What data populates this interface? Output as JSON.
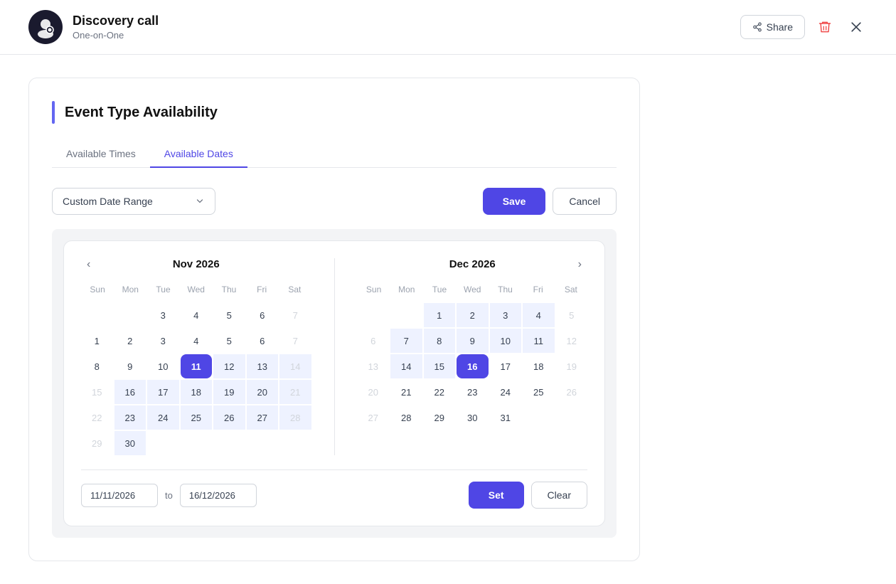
{
  "header": {
    "title": "Discovery call",
    "subtitle": "One-on-One",
    "share_label": "Share",
    "accent_color": "#4f46e5",
    "delete_color": "#ef4444"
  },
  "section": {
    "title": "Event Type Availability"
  },
  "tabs": [
    {
      "label": "Available Times",
      "active": false
    },
    {
      "label": "Available Dates",
      "active": true
    }
  ],
  "toolbar": {
    "dropdown_label": "Custom Date Range",
    "save_label": "Save",
    "cancel_label": "Cancel"
  },
  "calendars": [
    {
      "id": "nov2026",
      "month_label": "Nov 2026",
      "day_headers": [
        "Sun",
        "Mon",
        "Tue",
        "Wed",
        "Thu",
        "Fri",
        "Sat"
      ],
      "weeks": [
        [
          {
            "day": "",
            "state": "empty"
          },
          {
            "day": "",
            "state": "empty"
          },
          {
            "day": "3",
            "state": "normal"
          },
          {
            "day": "4",
            "state": "normal"
          },
          {
            "day": "5",
            "state": "normal"
          },
          {
            "day": "6",
            "state": "normal"
          },
          {
            "day": "7",
            "state": "greyed"
          }
        ],
        [
          {
            "day": "1",
            "state": "normal"
          },
          {
            "day": "2",
            "state": "normal"
          },
          {
            "day": "3",
            "state": "normal"
          },
          {
            "day": "4",
            "state": "normal"
          },
          {
            "day": "5",
            "state": "normal"
          },
          {
            "day": "6",
            "state": "normal"
          },
          {
            "day": "7",
            "state": "greyed"
          }
        ],
        [
          {
            "day": "8",
            "state": "normal"
          },
          {
            "day": "9",
            "state": "normal"
          },
          {
            "day": "10",
            "state": "normal"
          },
          {
            "day": "11",
            "state": "selected"
          },
          {
            "day": "12",
            "state": "in-range"
          },
          {
            "day": "13",
            "state": "in-range"
          },
          {
            "day": "14",
            "state": "in-range-greyed"
          }
        ],
        [
          {
            "day": "15",
            "state": "greyed"
          },
          {
            "day": "16",
            "state": "in-range"
          },
          {
            "day": "17",
            "state": "in-range"
          },
          {
            "day": "18",
            "state": "in-range"
          },
          {
            "day": "19",
            "state": "in-range"
          },
          {
            "day": "20",
            "state": "in-range"
          },
          {
            "day": "21",
            "state": "in-range-greyed"
          }
        ],
        [
          {
            "day": "22",
            "state": "greyed"
          },
          {
            "day": "23",
            "state": "in-range"
          },
          {
            "day": "24",
            "state": "in-range"
          },
          {
            "day": "25",
            "state": "in-range"
          },
          {
            "day": "26",
            "state": "in-range"
          },
          {
            "day": "27",
            "state": "in-range"
          },
          {
            "day": "28",
            "state": "in-range-greyed"
          }
        ],
        [
          {
            "day": "29",
            "state": "greyed"
          },
          {
            "day": "30",
            "state": "in-range"
          },
          {
            "day": "",
            "state": "empty"
          },
          {
            "day": "",
            "state": "empty"
          },
          {
            "day": "",
            "state": "empty"
          },
          {
            "day": "",
            "state": "empty"
          },
          {
            "day": "",
            "state": "empty"
          }
        ]
      ]
    },
    {
      "id": "dec2026",
      "month_label": "Dec 2026",
      "day_headers": [
        "Sun",
        "Mon",
        "Tue",
        "Wed",
        "Thu",
        "Fri",
        "Sat"
      ],
      "weeks": [
        [
          {
            "day": "",
            "state": "empty"
          },
          {
            "day": "",
            "state": "empty"
          },
          {
            "day": "1",
            "state": "in-range"
          },
          {
            "day": "2",
            "state": "in-range"
          },
          {
            "day": "3",
            "state": "in-range"
          },
          {
            "day": "4",
            "state": "in-range"
          },
          {
            "day": "5",
            "state": "greyed"
          }
        ],
        [
          {
            "day": "6",
            "state": "greyed"
          },
          {
            "day": "7",
            "state": "in-range"
          },
          {
            "day": "8",
            "state": "in-range"
          },
          {
            "day": "9",
            "state": "in-range"
          },
          {
            "day": "10",
            "state": "in-range"
          },
          {
            "day": "11",
            "state": "in-range"
          },
          {
            "day": "12",
            "state": "greyed"
          }
        ],
        [
          {
            "day": "13",
            "state": "greyed"
          },
          {
            "day": "14",
            "state": "in-range"
          },
          {
            "day": "15",
            "state": "in-range"
          },
          {
            "day": "16",
            "state": "selected"
          },
          {
            "day": "17",
            "state": "normal"
          },
          {
            "day": "18",
            "state": "normal"
          },
          {
            "day": "19",
            "state": "greyed"
          }
        ],
        [
          {
            "day": "20",
            "state": "greyed"
          },
          {
            "day": "21",
            "state": "normal"
          },
          {
            "day": "22",
            "state": "normal"
          },
          {
            "day": "23",
            "state": "normal"
          },
          {
            "day": "24",
            "state": "normal"
          },
          {
            "day": "25",
            "state": "normal"
          },
          {
            "day": "26",
            "state": "greyed"
          }
        ],
        [
          {
            "day": "27",
            "state": "greyed"
          },
          {
            "day": "28",
            "state": "normal"
          },
          {
            "day": "29",
            "state": "normal"
          },
          {
            "day": "30",
            "state": "normal"
          },
          {
            "day": "31",
            "state": "normal"
          },
          {
            "day": "",
            "state": "empty"
          },
          {
            "day": "",
            "state": "empty"
          }
        ]
      ]
    }
  ],
  "footer": {
    "start_date": "11/11/2026",
    "separator": "to",
    "end_date": "16/12/2026",
    "set_label": "Set",
    "clear_label": "Clear"
  }
}
